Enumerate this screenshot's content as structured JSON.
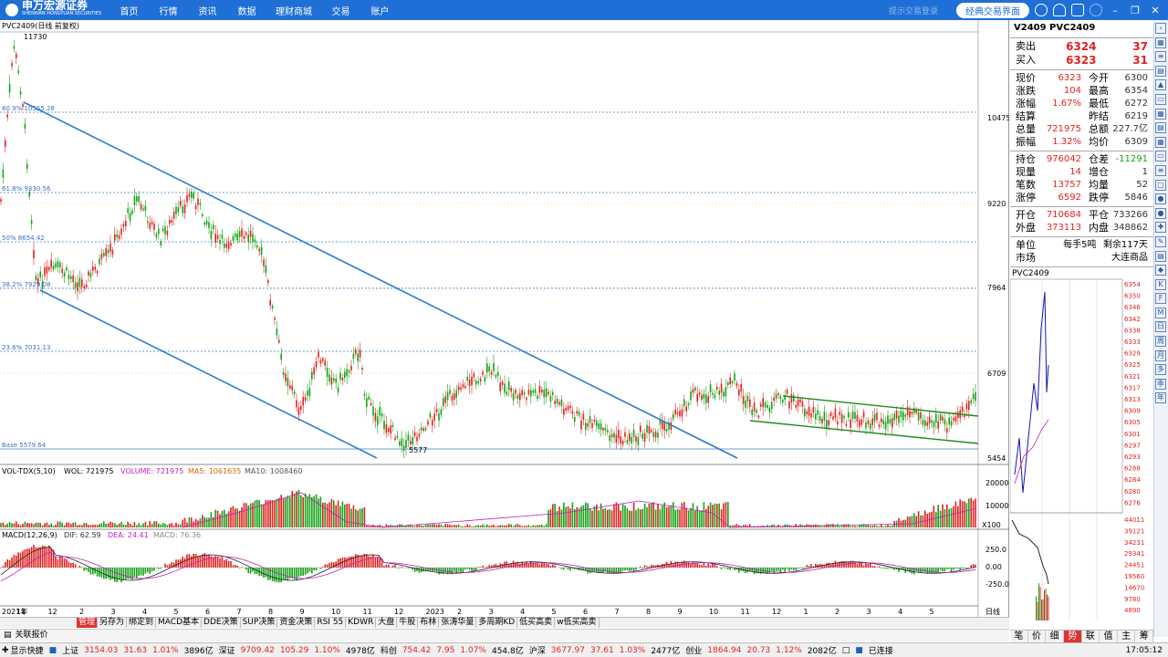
{
  "topbar": {
    "brand": "申万宏源证券",
    "brand_sub": "SHENWAN HONGYUAN SECURITIES",
    "menu": [
      "首页",
      "行情",
      "资讯",
      "数据",
      "理财商城",
      "交易",
      "账户"
    ],
    "login_hint": "提示交易登录",
    "classic_btn": "经典交易界面"
  },
  "chart": {
    "title": "PVC2409(日线 前复权)",
    "price_high_label": "11730",
    "price_low_label": "5577",
    "fib_labels": [
      "80.9% 10555.28",
      "61.8% 9330.56",
      "50% 8654.42",
      "38.2% 7929.08",
      "23.6% 7031.13",
      "Base 5579.64"
    ],
    "y_axis": [
      "10475",
      "9220",
      "7964",
      "6709",
      "5454"
    ],
    "vol_header": {
      "name": "VOL-TDX(5,10)",
      "vol_label": "VOLUME: 721975",
      "ma5": "MA5: 1061635",
      "ma10": "MA10: 1008460",
      "wol": "WOL: 721975"
    },
    "vol_axis": [
      "20000",
      "10000",
      "X100"
    ],
    "macd_header": {
      "name": "MACD(12,26,9)",
      "dif": "DIF: 62.59",
      "dea": "DEA: 24.41",
      "macd": "MACD: 76.36"
    },
    "macd_axis": [
      "250.0",
      "0.00",
      "-250.0"
    ],
    "x_axis": [
      "2021年",
      "11",
      "12",
      "2",
      "3",
      "4",
      "5",
      "6",
      "7",
      "8",
      "9",
      "10",
      "11",
      "12",
      "2023",
      "2",
      "3",
      "4",
      "5",
      "6",
      "7",
      "8",
      "9",
      "10",
      "11",
      "12",
      "1",
      "2",
      "3",
      "4",
      "5"
    ],
    "period_label": "日线"
  },
  "quote": {
    "contract": "V2409 PVC2409",
    "sell_label": "卖出",
    "sell_price": "6324",
    "sell_vol": "37",
    "buy_label": "买入",
    "buy_price": "6323",
    "buy_vol": "31",
    "rows1": [
      [
        "现价",
        "6323",
        "今开",
        "6300"
      ],
      [
        "涨跌",
        "104",
        "最高",
        "6354"
      ],
      [
        "涨幅",
        "1.67%",
        "最低",
        "6272"
      ],
      [
        "结算",
        "",
        "昨结",
        "6219"
      ],
      [
        "总量",
        "721975",
        "总额",
        "227.7亿"
      ],
      [
        "振幅",
        "1.32%",
        "均价",
        "6309"
      ]
    ],
    "rows2": [
      [
        "持仓",
        "976042",
        "仓差",
        "-11291"
      ],
      [
        "现量",
        "14",
        "增仓",
        "1"
      ],
      [
        "笔数",
        "13757",
        "均量",
        "52"
      ],
      [
        "涨停",
        "6592",
        "跌停",
        "5846"
      ]
    ],
    "rows3": [
      [
        "开仓",
        "710684",
        "平仓",
        "733266"
      ],
      [
        "外盘",
        "373113",
        "内盘",
        "348862"
      ]
    ],
    "unit_label": "单位",
    "unit_value": "每手5吨",
    "remain": "剩余117天",
    "market_label": "市场",
    "market_value": "大连商品",
    "mini_title": "PVC2409",
    "mini_axis": [
      "6354",
      "6350",
      "6346",
      "6342",
      "6338",
      "6333",
      "6329",
      "6325",
      "6321",
      "6317",
      "6313",
      "6309",
      "6305",
      "6301",
      "6297",
      "6293",
      "6288",
      "6284",
      "6280",
      "6276"
    ],
    "mini_vol_axis": [
      "44011",
      "39121",
      "34231",
      "29341",
      "24451",
      "19560",
      "14670",
      "9780",
      "4890"
    ]
  },
  "bottomtabs": [
    "管理",
    "另存为",
    "绑定到",
    "MACD基本",
    "DDE决策",
    "SUP决策",
    "资金决策",
    "RSI 55",
    "KDWR",
    "大盘",
    "牛股",
    "布林",
    "张涛华量",
    "多周期KD",
    "低买高卖",
    "w低买高卖"
  ],
  "rtabs": [
    "笔",
    "价",
    "细",
    "势",
    "联",
    "值",
    "主",
    "筹"
  ],
  "alert": "关联报价",
  "status": {
    "quick": "显示快捷",
    "sh_name": "上证",
    "sh_val": "3154.03",
    "sh_chg": "31.63",
    "sh_pct": "1.01%",
    "sh_amt": "3896亿",
    "sz_name": "深证",
    "sz_val": "9709.42",
    "sz_chg": "105.29",
    "sz_pct": "1.10%",
    "sz_amt": "4978亿",
    "kc_name": "科创",
    "kc_val": "754.42",
    "kc_chg": "7.95",
    "kc_pct": "1.07%",
    "kc_amt": "454.8亿",
    "hs_name": "沪深",
    "hs_val": "3677.97",
    "hs_chg": "37.61",
    "hs_pct": "1.03%",
    "hs_amt": "2477亿",
    "cy_name": "创业",
    "cy_val": "1864.94",
    "cy_chg": "20.73",
    "cy_pct": "1.12%",
    "cy_amt": "2082亿",
    "conn": "已连接",
    "time": "17:05:12"
  }
}
